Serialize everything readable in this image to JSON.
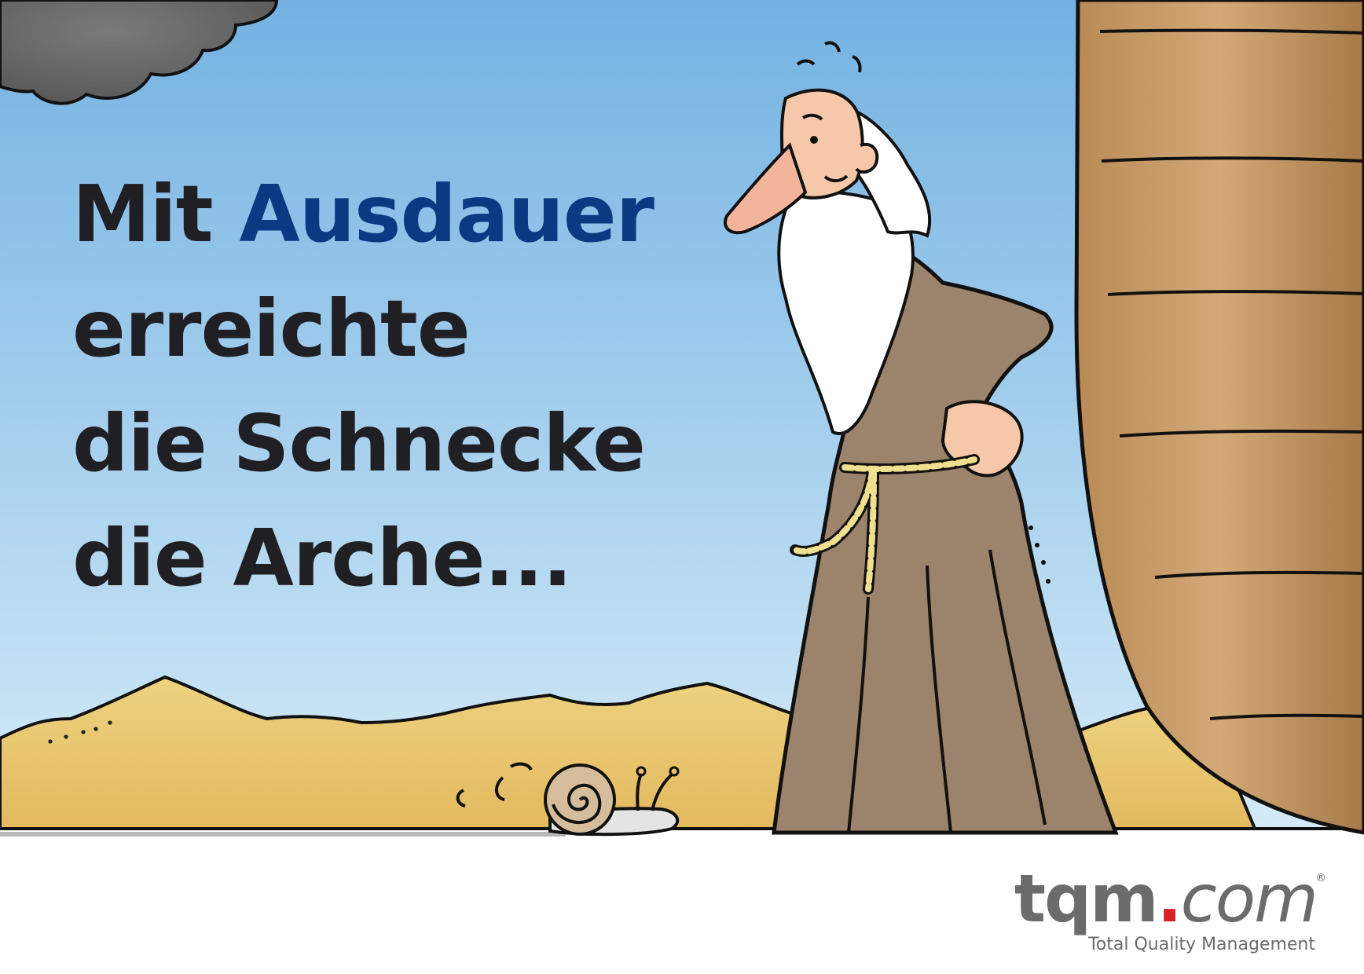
{
  "headline": {
    "line1_word1": "Mit",
    "line1_word2": "Ausdauer",
    "line2": "erreichte",
    "line3": "die Schnecke",
    "line4": "die Arche..."
  },
  "logo": {
    "tqm": "tqm",
    "dot": ".",
    "com": "com",
    "registered": "®",
    "tagline": "Total Quality Management"
  },
  "colors": {
    "sky_top": "#74b2e2",
    "sky_bottom": "#d6ecf8",
    "headline": "#1f1f24",
    "accent": "#0a3a82",
    "robe": "#9c836b",
    "ark": "#c59a66",
    "sand": "#e8c46a",
    "logo_gray": "#6b6b6b",
    "logo_red": "#d9212a"
  }
}
